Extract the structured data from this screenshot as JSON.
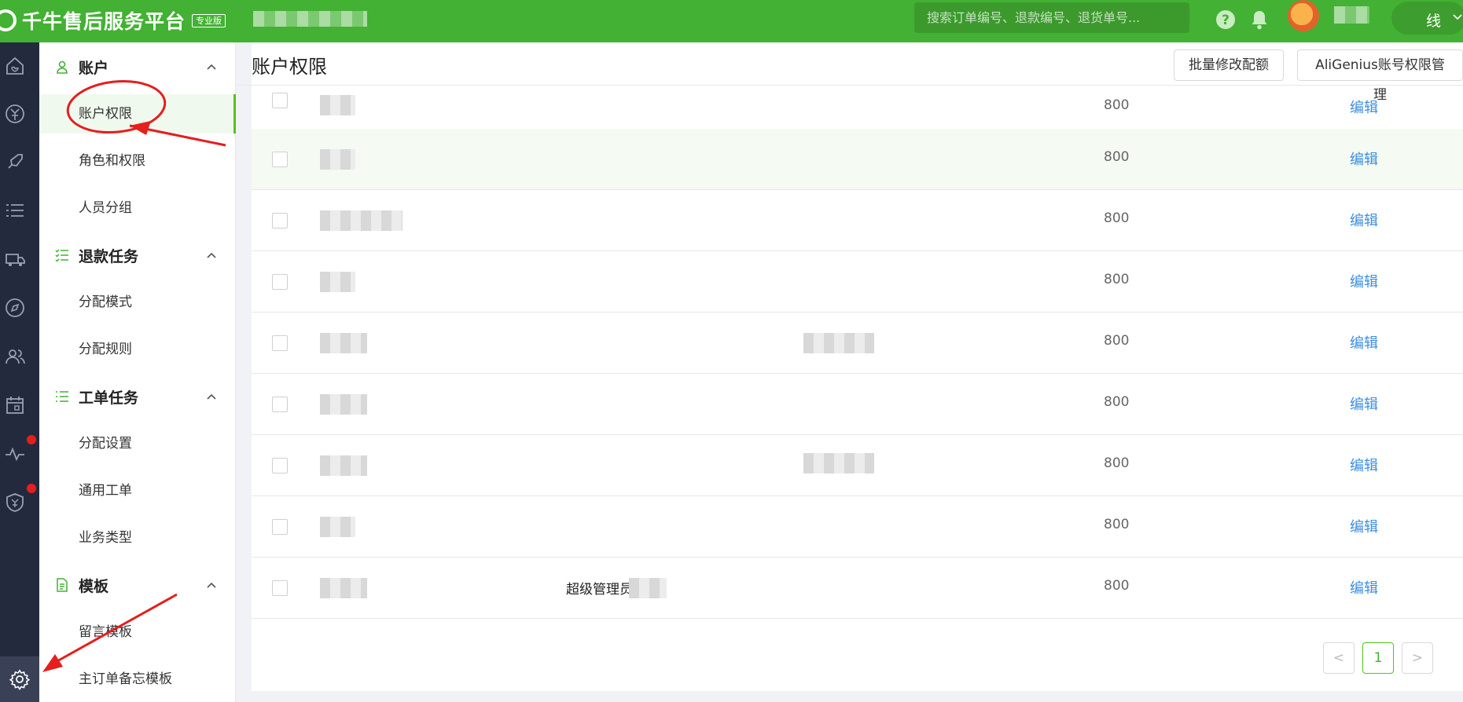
{
  "header": {
    "app_title": "千牛售后服务平台",
    "edition_badge": "专业版",
    "search_placeholder": "搜索订单编号、退款编号、退货单号...",
    "user_suffix": "线"
  },
  "sidebar": {
    "sections": [
      {
        "title": "账户",
        "icon": "user-icon",
        "items": [
          "账户权限",
          "角色和权限",
          "人员分组"
        ]
      },
      {
        "title": "退款任务",
        "icon": "task-list-icon",
        "items": [
          "分配模式",
          "分配规则"
        ]
      },
      {
        "title": "工单任务",
        "icon": "list-icon",
        "items": [
          "分配设置",
          "通用工单",
          "业务类型"
        ]
      },
      {
        "title": "模板",
        "icon": "document-icon",
        "items": [
          "留言模板",
          "主订单备忘模板"
        ]
      }
    ],
    "active_item": "账户权限"
  },
  "main": {
    "page_title": "账户权限",
    "actions": {
      "batch_quota": "批量修改配额",
      "aligenius_perm": "AliGenius账号权限管理"
    },
    "rows": [
      {
        "role": "",
        "quota": "800",
        "action": "编辑"
      },
      {
        "role": "",
        "quota": "800",
        "action": "编辑"
      },
      {
        "role": "",
        "quota": "800",
        "action": "编辑"
      },
      {
        "role": "",
        "quota": "800",
        "action": "编辑"
      },
      {
        "role": "",
        "quota": "800",
        "action": "编辑"
      },
      {
        "role": "",
        "quota": "800",
        "action": "编辑"
      },
      {
        "role": "",
        "quota": "800",
        "action": "编辑"
      },
      {
        "role": "",
        "quota": "800",
        "action": "编辑"
      },
      {
        "role": "超级管理员",
        "quota": "800",
        "action": "编辑"
      }
    ],
    "pagination": {
      "prev": "<",
      "current": "1",
      "next": ">"
    }
  },
  "colors": {
    "brand_green": "#43b133",
    "rail_dark": "#232a3e",
    "link_blue": "#3d8ee0",
    "annotation_red": "#e51e1e"
  }
}
